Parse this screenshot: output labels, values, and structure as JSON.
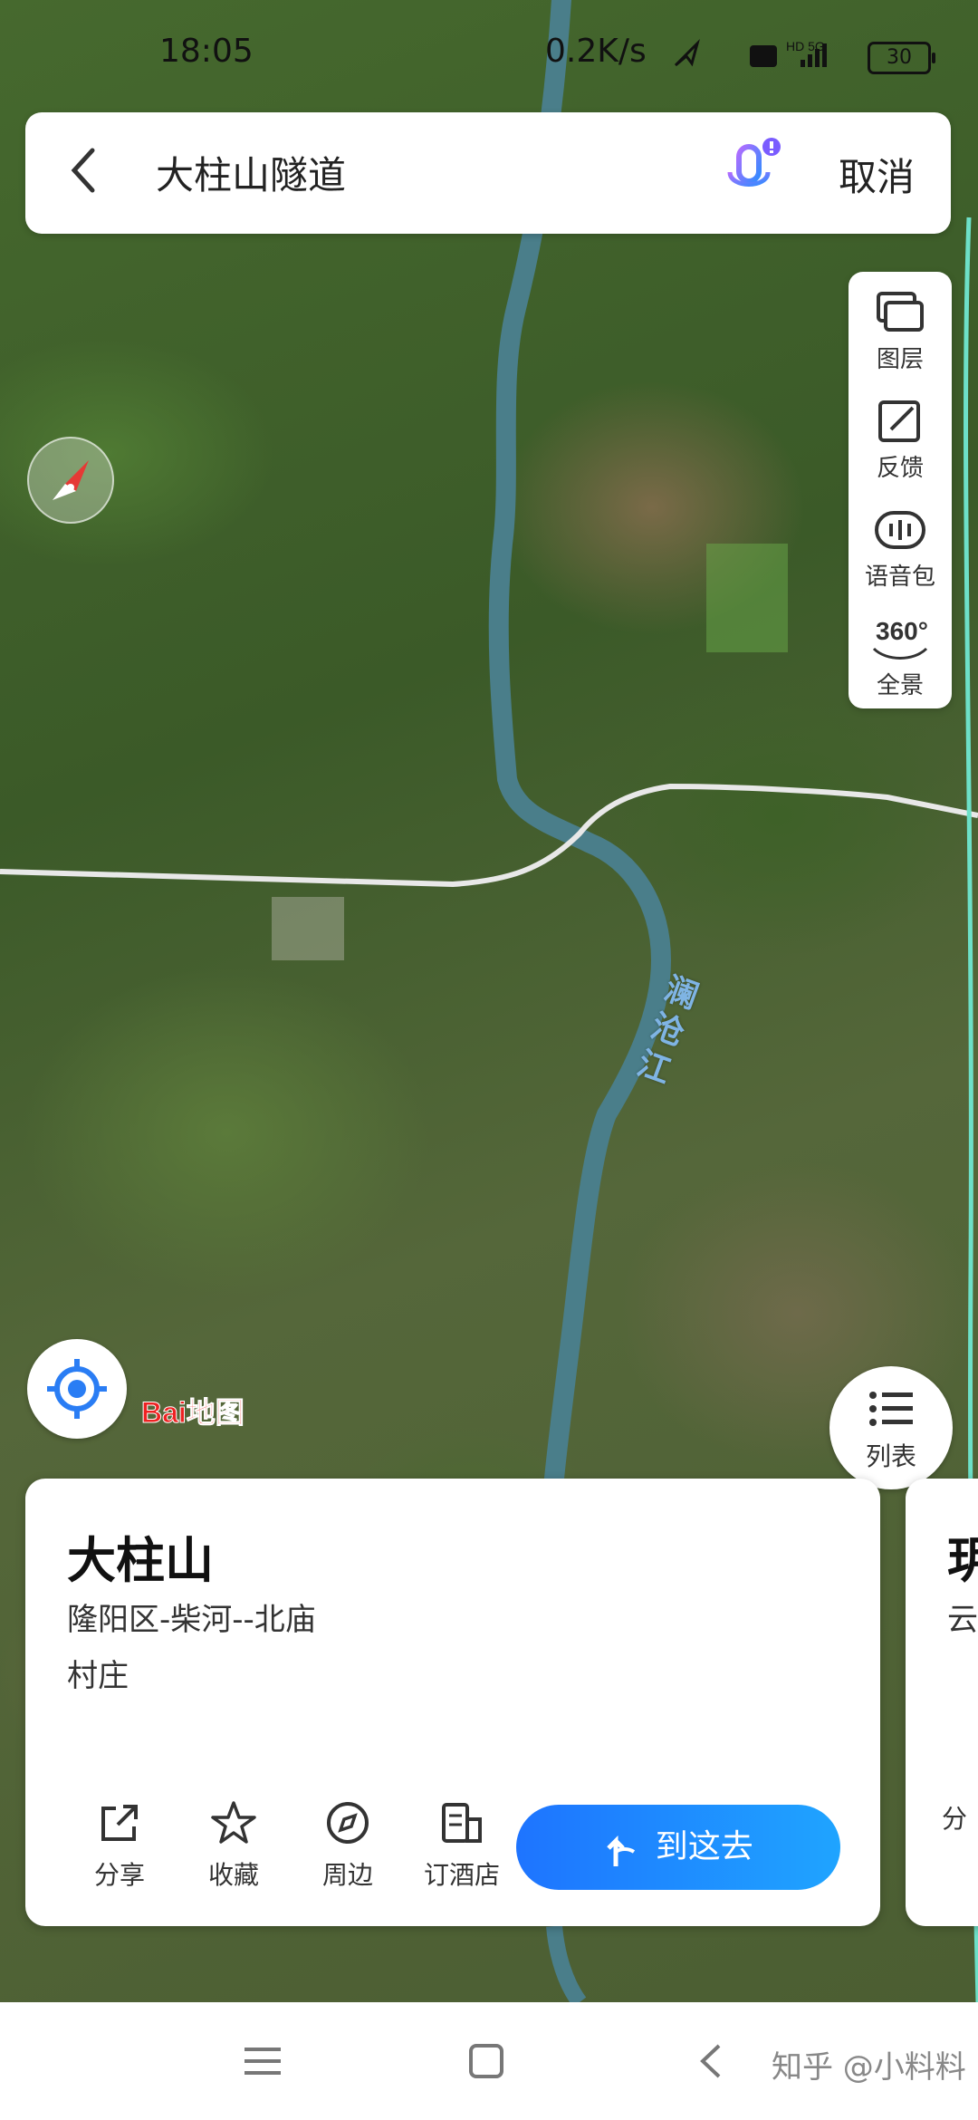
{
  "status_bar": {
    "time": "18:05",
    "network_speed": "0.2K/s",
    "indicators": "HD 5G",
    "battery": "30"
  },
  "search": {
    "query": "大柱山隧道",
    "cancel_label": "取消"
  },
  "map_tools": [
    {
      "label": "图层",
      "icon": "layers-icon"
    },
    {
      "label": "反馈",
      "icon": "feedback-icon"
    },
    {
      "label": "语音包",
      "icon": "voice-pack-icon"
    },
    {
      "label": "全景",
      "icon": "panorama-360-icon"
    }
  ],
  "panorama_badge": "360°",
  "map": {
    "river_label": "澜沧江",
    "logo_text": "Bai地图"
  },
  "list_button": {
    "label": "列表"
  },
  "place_card": {
    "title": "大柱山",
    "address": "隆阳区-柴河--北庙",
    "category": "村庄",
    "actions": [
      {
        "label": "分享",
        "icon": "share-icon"
      },
      {
        "label": "收藏",
        "icon": "star-icon"
      },
      {
        "label": "周边",
        "icon": "compass-nearby-icon"
      },
      {
        "label": "订酒店",
        "icon": "hotel-icon"
      }
    ],
    "go_label": "到这去"
  },
  "next_card": {
    "title_partial": "玥",
    "subtitle_partial": "云",
    "action_partial": "分"
  },
  "watermark": "知乎 @小料料",
  "colors": {
    "primary": "#1e74ff",
    "river": "#4a7e8a"
  }
}
